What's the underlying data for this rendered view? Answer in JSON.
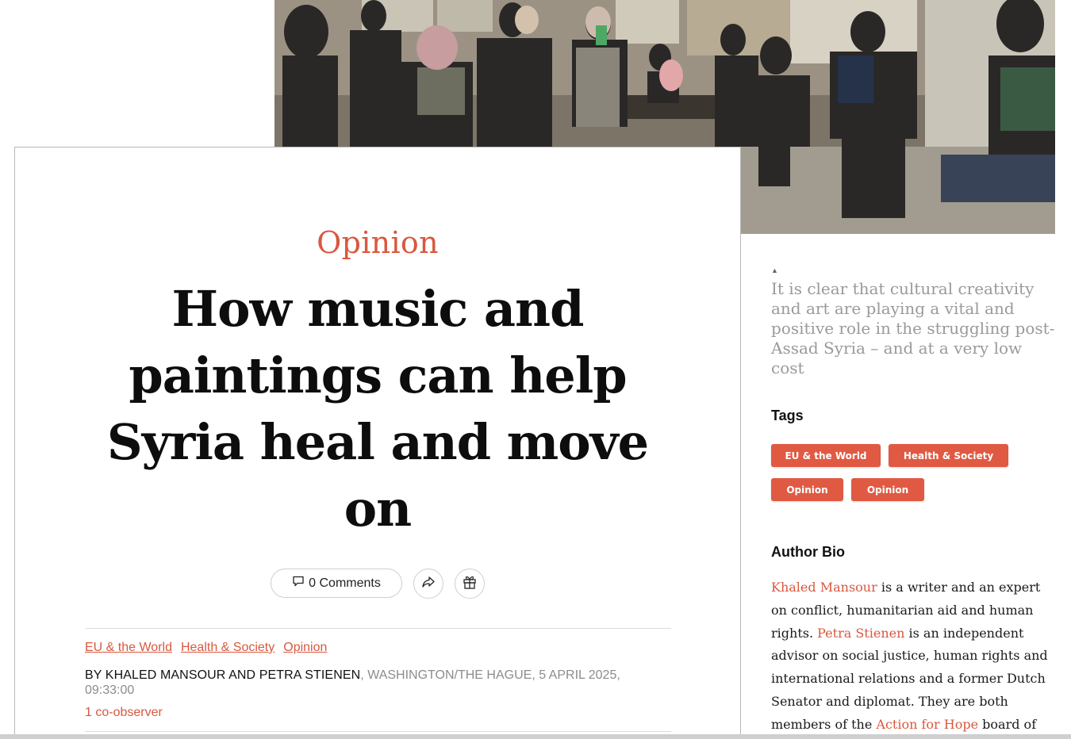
{
  "article": {
    "kicker": "Opinion",
    "headline": "How music and paintings can help Syria heal and move on",
    "comments_label": "0 Comments",
    "tag_links": [
      "EU & the World",
      "Health & Society",
      "Opinion"
    ],
    "byline_authors": "BY KHALED MANSOUR AND PETRA STIENEN",
    "byline_meta": ", WASHINGTON/THE HAGUE, 5 APRIL 2025, 09:33:00",
    "co_observer": "1 co-observer"
  },
  "sidebar": {
    "caption": "It is clear that cultural creativity and art are playing a vital and positive role in the struggling post-Assad Syria – and at a very low cost",
    "tags_title": "Tags",
    "tags": [
      "EU & the World",
      "Health & Society",
      "Opinion",
      "Opinion"
    ],
    "bio_title": "Author Bio",
    "bio": {
      "author1": "Khaled Mansour",
      "text1": " is a writer and an expert on conflict, humanitarian aid and human rights. ",
      "author2": "Petra Stienen",
      "text2": " is an independent advisor on social justice, human rights and international relations and a former Dutch Senator and diplomat. They are both members of the ",
      "org": "Action for Hope",
      "text3": " board of directors and have"
    }
  },
  "icons": {
    "comments": "speech-bubble-icon",
    "share": "share-arrow-icon",
    "gift": "gift-icon",
    "caret": "caret-up-icon"
  },
  "colors": {
    "accent": "#d9583f",
    "pill": "#e05a43",
    "caption": "#9a9a9a"
  }
}
